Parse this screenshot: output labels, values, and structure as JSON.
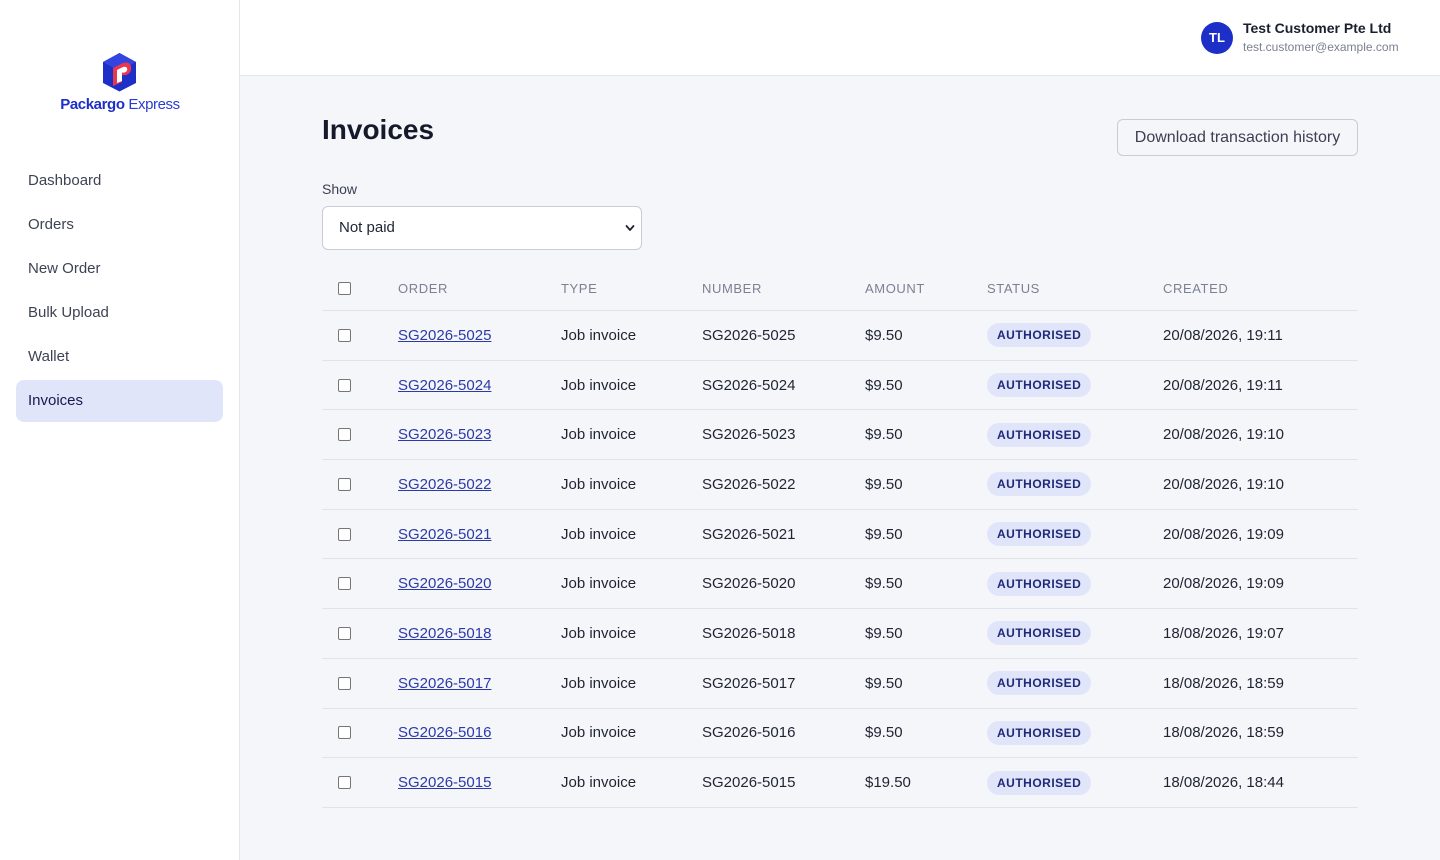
{
  "brand": {
    "name": "Packargo",
    "suffix": " Express",
    "colors": {
      "primary": "#1e2fc8",
      "accent": "#e8384f"
    }
  },
  "sidebar": {
    "items": [
      {
        "label": "Dashboard",
        "active": false
      },
      {
        "label": "Orders",
        "active": false
      },
      {
        "label": "New Order",
        "active": false
      },
      {
        "label": "Bulk Upload",
        "active": false
      },
      {
        "label": "Wallet",
        "active": false
      },
      {
        "label": "Invoices",
        "active": true
      }
    ]
  },
  "header": {
    "avatar_initials": "TL",
    "user_name": "Test Customer Pte Ltd",
    "user_email": "test.customer@example.com"
  },
  "main": {
    "title": "Invoices",
    "download_button": "Download transaction history",
    "filter": {
      "label": "Show",
      "selected": "Not paid"
    }
  },
  "table": {
    "columns": [
      "Order",
      "Type",
      "Number",
      "Amount",
      "Status",
      "Created"
    ],
    "rows": [
      {
        "order": "SG2026-5025",
        "type": "Job invoice",
        "number": "SG2026-5025",
        "amount": "$9.50",
        "status": "AUTHORISED",
        "created": "20/08/2026, 19:11"
      },
      {
        "order": "SG2026-5024",
        "type": "Job invoice",
        "number": "SG2026-5024",
        "amount": "$9.50",
        "status": "AUTHORISED",
        "created": "20/08/2026, 19:11"
      },
      {
        "order": "SG2026-5023",
        "type": "Job invoice",
        "number": "SG2026-5023",
        "amount": "$9.50",
        "status": "AUTHORISED",
        "created": "20/08/2026, 19:10"
      },
      {
        "order": "SG2026-5022",
        "type": "Job invoice",
        "number": "SG2026-5022",
        "amount": "$9.50",
        "status": "AUTHORISED",
        "created": "20/08/2026, 19:10"
      },
      {
        "order": "SG2026-5021",
        "type": "Job invoice",
        "number": "SG2026-5021",
        "amount": "$9.50",
        "status": "AUTHORISED",
        "created": "20/08/2026, 19:09"
      },
      {
        "order": "SG2026-5020",
        "type": "Job invoice",
        "number": "SG2026-5020",
        "amount": "$9.50",
        "status": "AUTHORISED",
        "created": "20/08/2026, 19:09"
      },
      {
        "order": "SG2026-5018",
        "type": "Job invoice",
        "number": "SG2026-5018",
        "amount": "$9.50",
        "status": "AUTHORISED",
        "created": "18/08/2026, 19:07"
      },
      {
        "order": "SG2026-5017",
        "type": "Job invoice",
        "number": "SG2026-5017",
        "amount": "$9.50",
        "status": "AUTHORISED",
        "created": "18/08/2026, 18:59"
      },
      {
        "order": "SG2026-5016",
        "type": "Job invoice",
        "number": "SG2026-5016",
        "amount": "$9.50",
        "status": "AUTHORISED",
        "created": "18/08/2026, 18:59"
      },
      {
        "order": "SG2026-5015",
        "type": "Job invoice",
        "number": "SG2026-5015",
        "amount": "$19.50",
        "status": "AUTHORISED",
        "created": "18/08/2026, 18:44"
      }
    ]
  }
}
